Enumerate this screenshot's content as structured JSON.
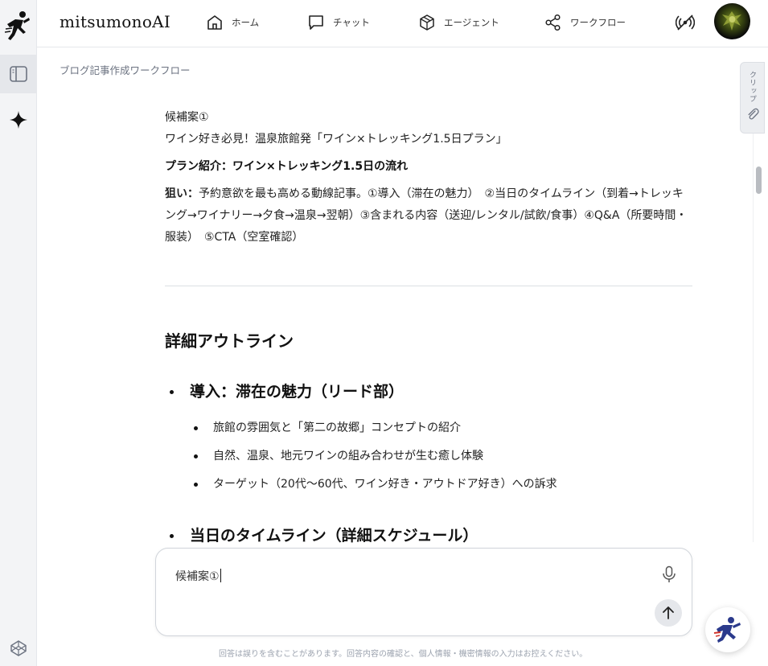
{
  "app": {
    "brand": "mitsumonoAI"
  },
  "nav": [
    {
      "label": "ホーム",
      "icon": "home-icon"
    },
    {
      "label": "チャット",
      "icon": "chat-icon"
    },
    {
      "label": "エージェント",
      "icon": "cube-icon"
    },
    {
      "label": "ワークフロー",
      "icon": "share-nodes-icon"
    }
  ],
  "breadcrumb": "ブログ記事作成ワークフロー",
  "clip_tab": {
    "label": "クリップ"
  },
  "content": {
    "candidate": "候補案①",
    "title": "ワイン好き必見！温泉旅館発「ワイン×トレッキング1.5日プラン」",
    "plan_heading": "プラン紹介：ワイン×トレッキング1.5日の流れ",
    "aim_label": "狙い：",
    "aim_text": "予約意欲を最も高める動線記事。①導入（滞在の魅力）　②当日のタイムライン（到着→トレッキング→ワイナリー→夕食→温泉→翌朝）③含まれる内容（送迎/レンタル/試飲/食事）④Q&A（所要時間・服装）　⑤CTA（空室確認）",
    "outline_heading": "詳細アウトライン",
    "section1": {
      "title": "導入：滞在の魅力（リード部）",
      "items": [
        "旅館の雰囲気と「第二の故郷」コンセプトの紹介",
        "自然、温泉、地元ワインの組み合わせが生む癒し体験",
        "ターゲット（20代〜60代、ワイン好き・アウトドア好き）への訴求"
      ]
    },
    "section2": {
      "title": "当日のタイムライン（詳細スケジュール）"
    }
  },
  "composer": {
    "value": "候補案①"
  },
  "disclaimer": "回答は誤りを含むことがあります。回答内容の確認と、個人情報・機密情報の入力はお控えください。"
}
